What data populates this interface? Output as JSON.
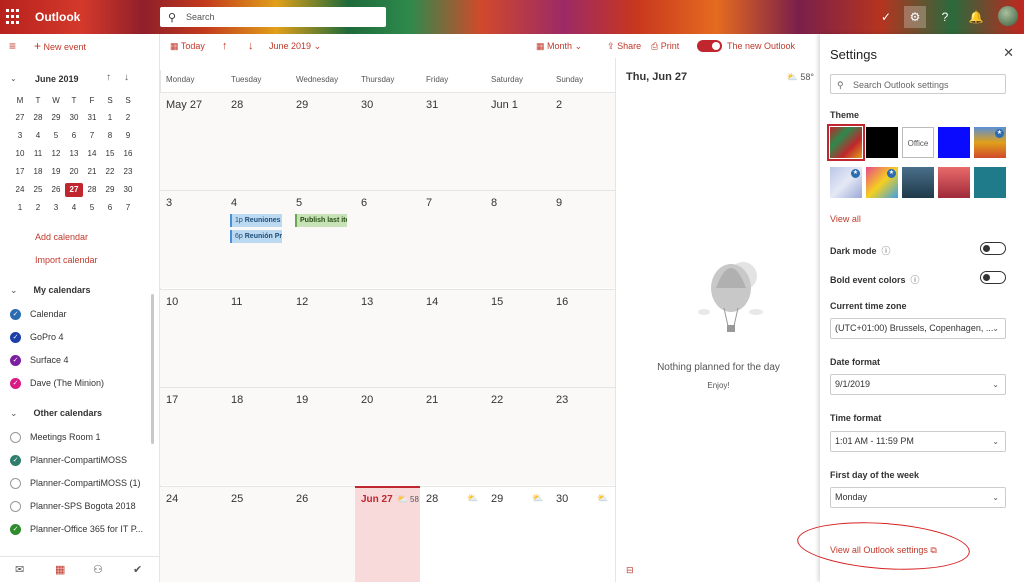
{
  "app": {
    "brand": "Outlook"
  },
  "search": {
    "placeholder": "Search"
  },
  "leftnav": {
    "new_event": "New event",
    "mini_month": "June 2019",
    "dow": [
      "M",
      "T",
      "W",
      "T",
      "F",
      "S",
      "S"
    ],
    "weeks": [
      [
        "27",
        "28",
        "29",
        "30",
        "31",
        "1",
        "2"
      ],
      [
        "3",
        "4",
        "5",
        "6",
        "7",
        "8",
        "9"
      ],
      [
        "10",
        "11",
        "12",
        "13",
        "14",
        "15",
        "16"
      ],
      [
        "17",
        "18",
        "19",
        "20",
        "21",
        "22",
        "23"
      ],
      [
        "24",
        "25",
        "26",
        "27",
        "28",
        "29",
        "30"
      ],
      [
        "1",
        "2",
        "3",
        "4",
        "5",
        "6",
        "7"
      ]
    ],
    "add_calendar": "Add calendar",
    "import_calendar": "Import calendar",
    "my_calendars_title": "My calendars",
    "my_calendars": [
      {
        "label": "Calendar",
        "color": "#2b6cb0"
      },
      {
        "label": "GoPro 4",
        "color": "#1a3fa8"
      },
      {
        "label": "Surface 4",
        "color": "#7b1fa2"
      },
      {
        "label": "Dave (The Minion)",
        "color": "#d81b85"
      }
    ],
    "other_calendars_title": "Other calendars",
    "other_calendars": [
      {
        "label": "Meetings Room 1",
        "color": ""
      },
      {
        "label": "Planner-CompartiMOSS",
        "color": "#2e7d6e"
      },
      {
        "label": "Planner-CompartiMOSS (1)",
        "color": ""
      },
      {
        "label": "Planner-SPS Bogota 2018",
        "color": ""
      },
      {
        "label": "Planner-Office 365 for IT P...",
        "color": "#2e8b2e"
      }
    ]
  },
  "toolbar": {
    "today": "Today",
    "range": "June 2019",
    "view": "Month",
    "share": "Share",
    "print": "Print",
    "new_outlook": "The new Outlook"
  },
  "month": {
    "days": [
      "Monday",
      "Tuesday",
      "Wednesday",
      "Thursday",
      "Friday",
      "Saturday",
      "Sunday"
    ],
    "weeks": [
      [
        "May 27",
        "28",
        "29",
        "30",
        "31",
        "Jun 1",
        "2"
      ],
      [
        "3",
        "4",
        "5",
        "6",
        "7",
        "8",
        "9"
      ],
      [
        "10",
        "11",
        "12",
        "13",
        "14",
        "15",
        "16"
      ],
      [
        "17",
        "18",
        "19",
        "20",
        "21",
        "22",
        "23"
      ],
      [
        "24",
        "25",
        "26",
        "Jun 27",
        "28",
        "29",
        "30"
      ]
    ],
    "today_temp": "58",
    "events": [
      {
        "time": "1p",
        "title": "Reuniones",
        "color": "blue"
      },
      {
        "time": "6p",
        "title": "Reunión Pr",
        "color": "blue"
      },
      {
        "time": "",
        "title": "Publish last ite",
        "color": "green"
      }
    ]
  },
  "agenda": {
    "date": "Thu, Jun 27",
    "temp": "58°",
    "empty_title": "Nothing planned for the day",
    "empty_sub": "Enjoy!"
  },
  "settings": {
    "title": "Settings",
    "search_placeholder": "Search Outlook settings",
    "theme_label": "Theme",
    "office_theme": "Office",
    "view_all": "View all",
    "dark_mode": "Dark mode",
    "bold_colors": "Bold event colors",
    "timezone_label": "Current time zone",
    "timezone_value": "(UTC+01:00) Brussels, Copenhagen, ...",
    "date_format_label": "Date format",
    "date_format_value": "9/1/2019",
    "time_format_label": "Time format",
    "time_format_value": "1:01 AM - 11:59 PM",
    "first_day_label": "First day of the week",
    "first_day_value": "Monday",
    "view_all_settings": "View all Outlook settings"
  }
}
